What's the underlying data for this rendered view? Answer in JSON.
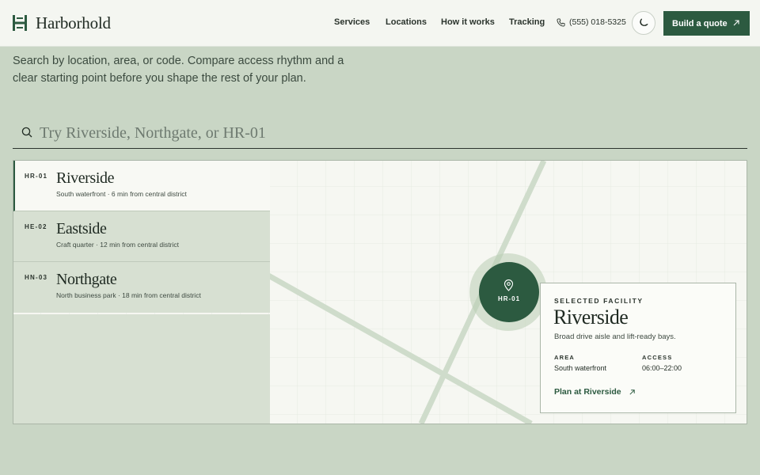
{
  "brand": {
    "name": "Harborhold"
  },
  "nav": {
    "items": [
      {
        "label": "Services"
      },
      {
        "label": "Locations"
      },
      {
        "label": "How it works"
      },
      {
        "label": "Tracking"
      }
    ],
    "phone": "(555) 018-5325",
    "cta_label": "Build a quote"
  },
  "intro": {
    "text": "Search by location, area, or code. Compare access rhythm and a clear starting point before you shape the rest of your plan."
  },
  "search": {
    "placeholder": "Try Riverside, Northgate, or HR-01",
    "value": ""
  },
  "facilities": [
    {
      "code": "HR-01",
      "name": "Riverside",
      "desc": "South waterfront · 6 min from central district",
      "active": true
    },
    {
      "code": "HE-02",
      "name": "Eastside",
      "desc": "Craft quarter · 12 min from central district",
      "active": false
    },
    {
      "code": "HN-03",
      "name": "Northgate",
      "desc": "North business park · 18 min from central district",
      "active": false
    }
  ],
  "map": {
    "marker_code": "HR-01"
  },
  "selected": {
    "kicker": "SELECTED FACILITY",
    "name": "Riverside",
    "desc": "Broad drive aisle and lift-ready bays.",
    "area_label": "AREA",
    "area_value": "South waterfront",
    "access_label": "ACCESS",
    "access_value": "06:00–22:00",
    "link_label": "Plan at Riverside"
  },
  "colors": {
    "accent": "#2c5a40",
    "background": "#c9d6c5",
    "surface": "#f6f7f2"
  }
}
